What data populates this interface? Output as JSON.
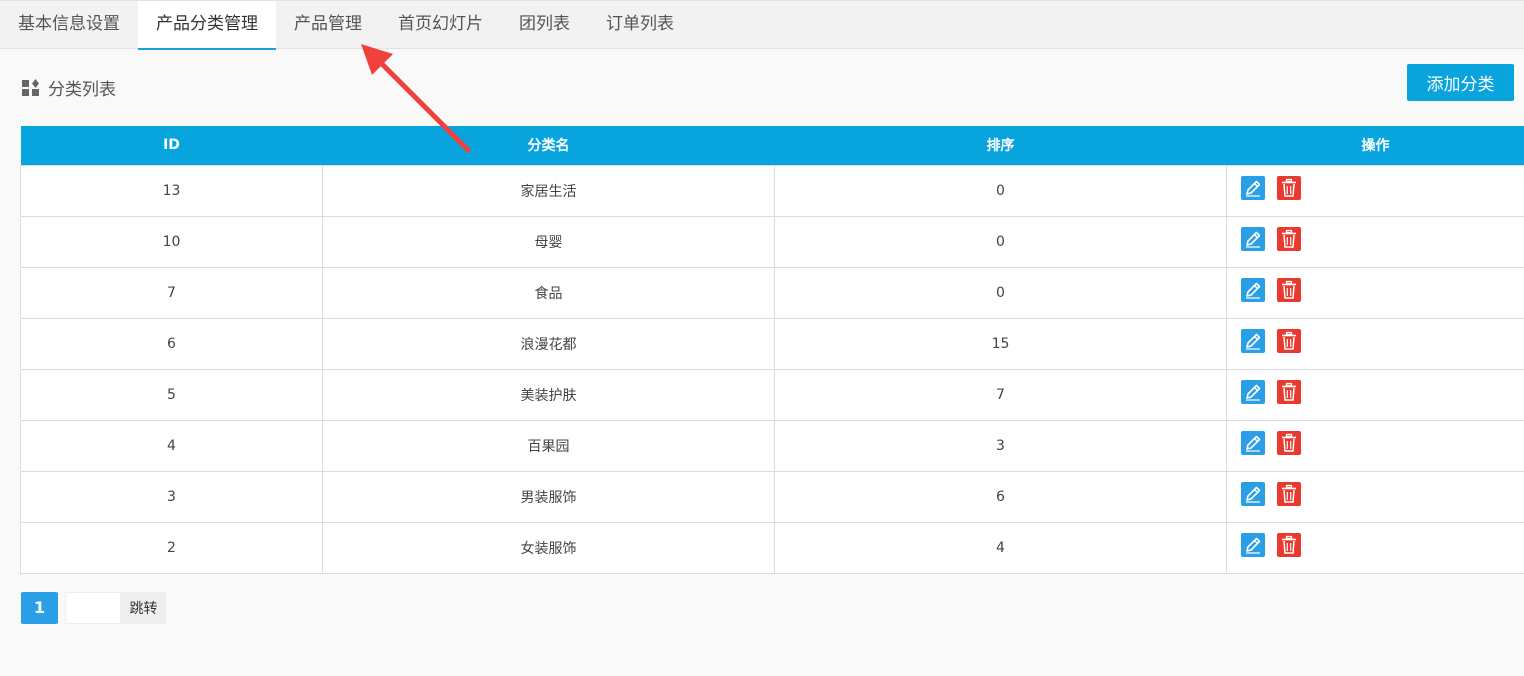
{
  "tabs": [
    {
      "label": "基本信息设置"
    },
    {
      "label": "产品分类管理"
    },
    {
      "label": "产品管理"
    },
    {
      "label": "首页幻灯片"
    },
    {
      "label": "团列表"
    },
    {
      "label": "订单列表"
    }
  ],
  "active_tab": 1,
  "section": {
    "title": "分类列表",
    "icon": "grid-shapes-icon"
  },
  "add_button": {
    "label": "添加分类"
  },
  "table": {
    "headers": [
      "ID",
      "分类名",
      "排序",
      "操作"
    ],
    "rows": [
      {
        "id": "13",
        "name": "家居生活",
        "sort": "0"
      },
      {
        "id": "10",
        "name": "母婴",
        "sort": "0"
      },
      {
        "id": "7",
        "name": "食品",
        "sort": "0"
      },
      {
        "id": "6",
        "name": "浪漫花都",
        "sort": "15"
      },
      {
        "id": "5",
        "name": "美装护肤",
        "sort": "7"
      },
      {
        "id": "4",
        "name": "百果园",
        "sort": "3"
      },
      {
        "id": "3",
        "name": "男装服饰",
        "sort": "6"
      },
      {
        "id": "2",
        "name": "女装服饰",
        "sort": "4"
      }
    ]
  },
  "pagination": {
    "current_page": "1",
    "input_value": "",
    "jump_label": "跳转"
  },
  "colors": {
    "accent": "#08a4dd",
    "edit": "#2b9fe6",
    "delete": "#e83a2e",
    "arrow": "#f0413a"
  }
}
